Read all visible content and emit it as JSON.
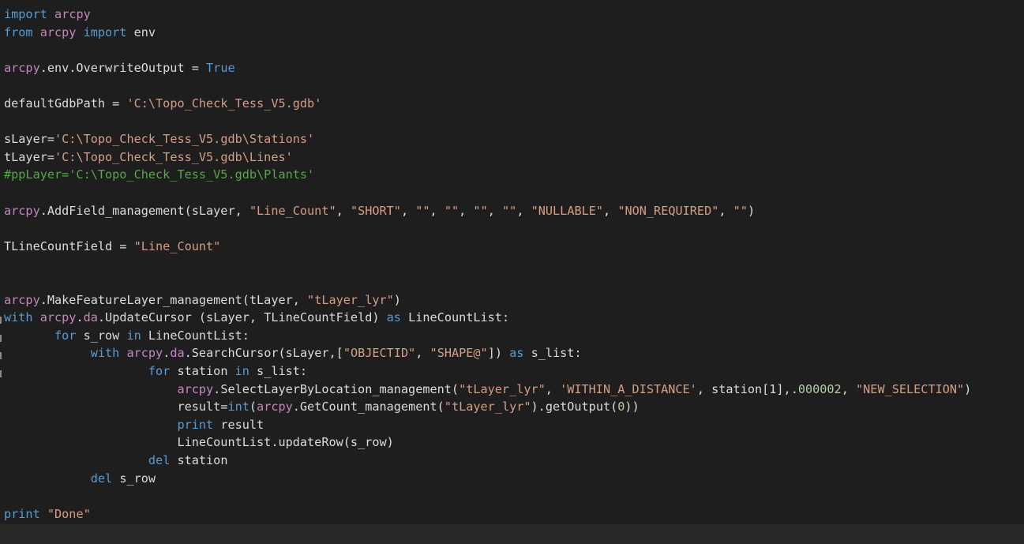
{
  "editor": {
    "lines": [
      [
        {
          "t": "import",
          "c": "kw"
        },
        {
          "t": " "
        },
        {
          "t": "arcpy",
          "c": "mod"
        }
      ],
      [
        {
          "t": "from",
          "c": "kw"
        },
        {
          "t": " "
        },
        {
          "t": "arcpy",
          "c": "mod"
        },
        {
          "t": " "
        },
        {
          "t": "import",
          "c": "kw"
        },
        {
          "t": " env"
        }
      ],
      [],
      [
        {
          "t": "arcpy",
          "c": "mod"
        },
        {
          "t": ".env.OverwriteOutput = "
        },
        {
          "t": "True",
          "c": "kw"
        }
      ],
      [],
      [
        {
          "t": "defaultGdbPath = "
        },
        {
          "t": "'C:\\Topo_Check_Tess_V5.gdb'",
          "c": "str"
        }
      ],
      [],
      [
        {
          "t": "sLayer="
        },
        {
          "t": "'C:\\Topo_Check_Tess_V5.gdb\\Stations'",
          "c": "str"
        }
      ],
      [
        {
          "t": "tLayer="
        },
        {
          "t": "'C:\\Topo_Check_Tess_V5.gdb\\Lines'",
          "c": "str"
        }
      ],
      [
        {
          "t": "#ppLayer='C:\\Topo_Check_Tess_V5.gdb\\Plants'",
          "c": "cmt"
        }
      ],
      [],
      [
        {
          "t": "arcpy",
          "c": "mod"
        },
        {
          "t": ".AddField_management(sLayer, "
        },
        {
          "t": "\"Line_Count\"",
          "c": "str"
        },
        {
          "t": ", "
        },
        {
          "t": "\"SHORT\"",
          "c": "str"
        },
        {
          "t": ", "
        },
        {
          "t": "\"\"",
          "c": "str"
        },
        {
          "t": ", "
        },
        {
          "t": "\"\"",
          "c": "str"
        },
        {
          "t": ", "
        },
        {
          "t": "\"\"",
          "c": "str"
        },
        {
          "t": ", "
        },
        {
          "t": "\"\"",
          "c": "str"
        },
        {
          "t": ", "
        },
        {
          "t": "\"NULLABLE\"",
          "c": "str"
        },
        {
          "t": ", "
        },
        {
          "t": "\"NON_REQUIRED\"",
          "c": "str"
        },
        {
          "t": ", "
        },
        {
          "t": "\"\"",
          "c": "str"
        },
        {
          "t": ")"
        }
      ],
      [],
      [
        {
          "t": "TLineCountField = "
        },
        {
          "t": "\"Line_Count\"",
          "c": "str"
        }
      ],
      [],
      [],
      [
        {
          "t": "arcpy",
          "c": "mod"
        },
        {
          "t": ".MakeFeatureLayer_management(tLayer, "
        },
        {
          "t": "\"tLayer_lyr\"",
          "c": "str"
        },
        {
          "t": ")"
        }
      ],
      [
        {
          "t": "with",
          "c": "kw"
        },
        {
          "t": " "
        },
        {
          "t": "arcpy",
          "c": "mod"
        },
        {
          "t": "."
        },
        {
          "t": "da",
          "c": "mod"
        },
        {
          "t": ".UpdateCursor (sLayer, TLineCountField) "
        },
        {
          "t": "as",
          "c": "kw"
        },
        {
          "t": " LineCountList:"
        }
      ],
      [
        {
          "t": "       "
        },
        {
          "t": "for",
          "c": "kw"
        },
        {
          "t": " s_row "
        },
        {
          "t": "in",
          "c": "kw"
        },
        {
          "t": " LineCountList:"
        }
      ],
      [
        {
          "t": "            "
        },
        {
          "t": "with",
          "c": "kw"
        },
        {
          "t": " "
        },
        {
          "t": "arcpy",
          "c": "mod"
        },
        {
          "t": "."
        },
        {
          "t": "da",
          "c": "mod"
        },
        {
          "t": ".SearchCursor(sLayer,["
        },
        {
          "t": "\"OBJECTID\"",
          "c": "str"
        },
        {
          "t": ", "
        },
        {
          "t": "\"SHAPE@\"",
          "c": "str"
        },
        {
          "t": "]) "
        },
        {
          "t": "as",
          "c": "kw"
        },
        {
          "t": " s_list:"
        }
      ],
      [
        {
          "t": "                    "
        },
        {
          "t": "for",
          "c": "kw"
        },
        {
          "t": " station "
        },
        {
          "t": "in",
          "c": "kw"
        },
        {
          "t": " s_list:"
        }
      ],
      [
        {
          "t": "                        "
        },
        {
          "t": "arcpy",
          "c": "mod"
        },
        {
          "t": ".SelectLayerByLocation_management("
        },
        {
          "t": "\"tLayer_lyr\"",
          "c": "str"
        },
        {
          "t": ", "
        },
        {
          "t": "'WITHIN_A_DISTANCE'",
          "c": "str"
        },
        {
          "t": ", station[1],."
        },
        {
          "t": "000002",
          "c": "num"
        },
        {
          "t": ", "
        },
        {
          "t": "\"NEW_SELECTION\"",
          "c": "str"
        },
        {
          "t": ")"
        }
      ],
      [
        {
          "t": "                        result="
        },
        {
          "t": "int",
          "c": "kw"
        },
        {
          "t": "("
        },
        {
          "t": "arcpy",
          "c": "mod"
        },
        {
          "t": ".GetCount_management("
        },
        {
          "t": "\"tLayer_lyr\"",
          "c": "str"
        },
        {
          "t": ").getOutput("
        },
        {
          "t": "0",
          "c": "num"
        },
        {
          "t": "))"
        }
      ],
      [
        {
          "t": "                        "
        },
        {
          "t": "print",
          "c": "kw"
        },
        {
          "t": " result"
        }
      ],
      [
        {
          "t": "                        LineCountList.updateRow(s_row)"
        }
      ],
      [
        {
          "t": "                    "
        },
        {
          "t": "del",
          "c": "kw"
        },
        {
          "t": " station"
        }
      ],
      [
        {
          "t": "            "
        },
        {
          "t": "del",
          "c": "kw"
        },
        {
          "t": " s_row"
        }
      ],
      [],
      [
        {
          "t": "print",
          "c": "kw"
        },
        {
          "t": " "
        },
        {
          "t": "\"Done\"",
          "c": "str"
        }
      ]
    ]
  }
}
